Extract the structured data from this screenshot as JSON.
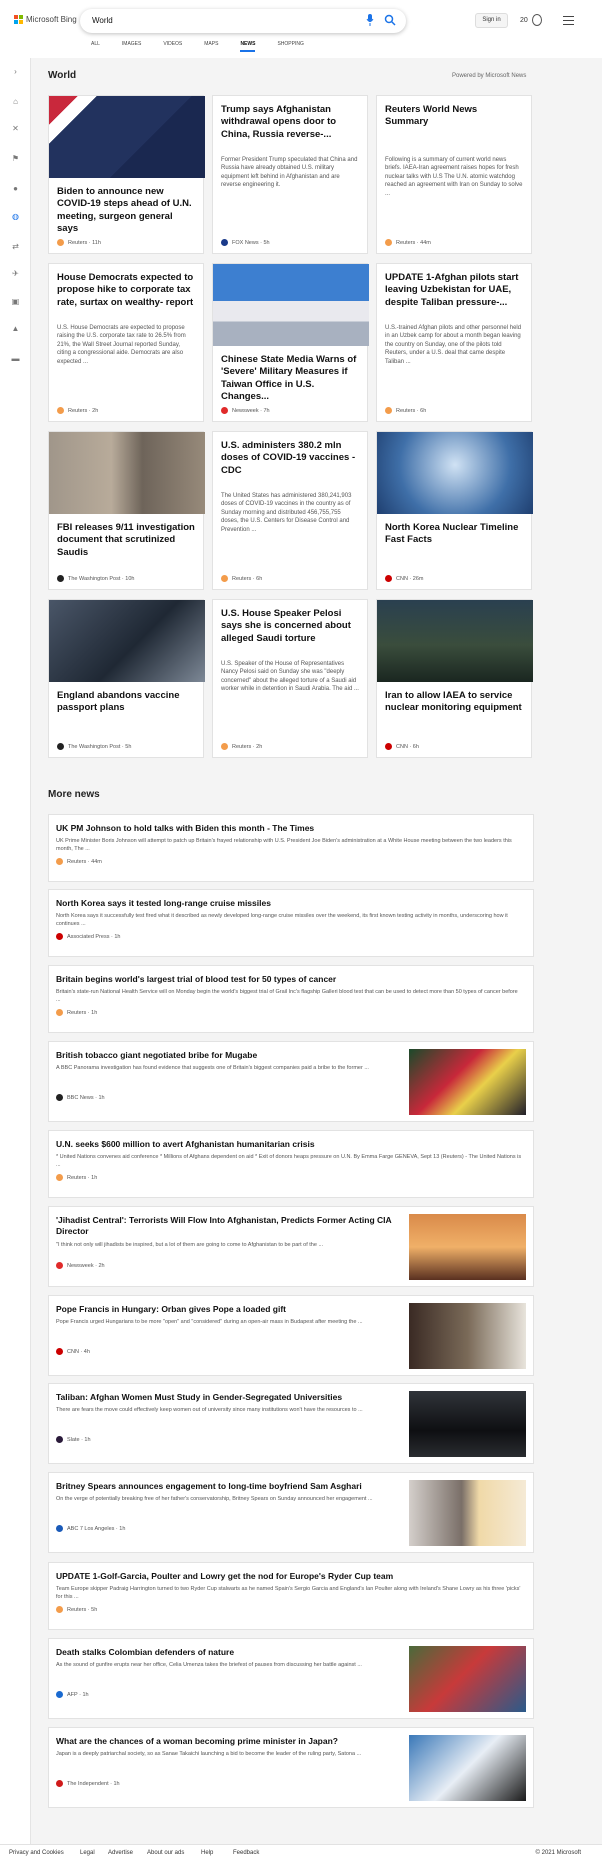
{
  "header": {
    "logo_text": "Microsoft Bing",
    "search_value": "World",
    "signin": "Sign in",
    "reward_count": "20"
  },
  "tabs": [
    "ALL",
    "IMAGES",
    "VIDEOS",
    "MAPS",
    "NEWS",
    "SHOPPING"
  ],
  "active_tab": "NEWS",
  "sidebar_icons": [
    "expand-icon",
    "home-icon",
    "sports-icon",
    "flag-icon",
    "location-icon",
    "globe-icon",
    "business-icon",
    "science-icon",
    "entertainment-icon",
    "politics-icon",
    "money-icon"
  ],
  "world": {
    "title": "World",
    "powered": "Powered by Microsoft News"
  },
  "cards": [
    {
      "title": "Biden to announce new COVID-19 steps ahead of U.N. meeting, surgeon general says",
      "snippet": "",
      "source": "Reuters · 11h",
      "fav": "#f39c4b"
    },
    {
      "title": "Trump says Afghanistan withdrawal opens door to China, Russia reverse-...",
      "snippet": "Former President Trump speculated that China and Russia have already obtained U.S. military equipment left behind in Afghanistan and are reverse engineering it.",
      "source": "FOX News · 5h",
      "fav": "#1a3a8a"
    },
    {
      "title": "Reuters World News Summary",
      "snippet": "Following is a summary of current world news briefs. IAEA-Iran agreement raises hopes for fresh nuclear talks with U.S The U.N. atomic watchdog reached an agreement with Iran on Sunday to solve ...",
      "source": "Reuters · 44m",
      "fav": "#f39c4b"
    },
    {
      "title": "House Democrats expected to propose hike to corporate tax rate, surtax on wealthy- report",
      "snippet": "U.S. House Democrats are expected to propose raising the U.S. corporate tax rate to 26.5% from 21%, the Wall Street Journal reported Sunday, citing a congressional aide. Democrats are also expected ...",
      "source": "Reuters · 2h",
      "fav": "#f39c4b"
    },
    {
      "title": "Chinese State Media Warns of 'Severe' Military Measures if Taiwan Office in U.S. Changes...",
      "snippet": "",
      "source": "Newsweek · 7h",
      "fav": "#e02a2a"
    },
    {
      "title": "UPDATE 1-Afghan pilots start leaving Uzbekistan for UAE, despite Taliban pressure-...",
      "snippet": "U.S.-trained Afghan pilots and other personnel held in an Uzbek camp for about a month began leaving the country on Sunday, one of the pilots told Reuters, under a U.S. deal that came despite Taliban ...",
      "source": "Reuters · 6h",
      "fav": "#f39c4b"
    },
    {
      "title": "FBI releases 9/11 investigation document that scrutinized Saudis",
      "snippet": "",
      "source": "The Washington Post · 10h",
      "fav": "#222"
    },
    {
      "title": "U.S. administers 380.2 mln doses of COVID-19 vaccines - CDC",
      "snippet": "The United States has administered 380,241,903 doses of COVID-19 vaccines in the country as of Sunday morning and distributed 456,755,755 doses, the U.S. Centers for Disease Control and Prevention ...",
      "source": "Reuters · 6h",
      "fav": "#f39c4b"
    },
    {
      "title": "North Korea Nuclear Timeline Fast Facts",
      "snippet": "",
      "source": "CNN · 26m",
      "fav": "#cc0000"
    },
    {
      "title": "England abandons vaccine passport plans",
      "snippet": "",
      "source": "The Washington Post · 5h",
      "fav": "#222"
    },
    {
      "title": "U.S. House Speaker Pelosi says she is concerned about alleged Saudi torture",
      "snippet": "U.S. Speaker of the House of Representatives Nancy Pelosi said on Sunday she was \"deeply concerned\" about the alleged torture of a Saudi aid worker while in detention in Saudi Arabia. The aid ...",
      "source": "Reuters · 2h",
      "fav": "#f39c4b"
    },
    {
      "title": "Iran to allow IAEA to service nuclear monitoring equipment",
      "snippet": "",
      "source": "CNN · 6h",
      "fav": "#cc0000"
    }
  ],
  "more_news": {
    "title": "More news",
    "items": [
      {
        "title": "UK PM Johnson to hold talks with Biden this month - The Times",
        "snippet": "UK Prime Minister Boris Johnson will attempt to patch up Britain's frayed relationship with U.S. President Joe Biden's administration at a White House meeting between the two leaders this month, The ...",
        "source": "Reuters · 44m",
        "fav": "#f39c4b"
      },
      {
        "title": "North Korea says it tested long-range cruise missiles",
        "snippet": "North Korea says it successfully test fired what it described as newly developed long-range cruise missiles over the weekend, its first known testing activity in months, underscoring how it continues ...",
        "source": "Associated Press · 1h",
        "fav": "#c00"
      },
      {
        "title": "Britain begins world's largest trial of blood test for 50 types of cancer",
        "snippet": "Britain's state-run National Health Service will on Monday begin the world's biggest trial of Grail Inc's flagship Galleri blood test that can be used to detect more than 50 types of cancer before ...",
        "source": "Reuters · 1h",
        "fav": "#f39c4b"
      },
      {
        "title": "British tobacco giant negotiated bribe for Mugabe",
        "snippet": "A BBC Panorama investigation has found evidence that suggests one of Britain's biggest companies paid a bribe to the former ...",
        "source": "BBC News · 1h",
        "fav": "#222"
      },
      {
        "title": "U.N. seeks $600 million to avert Afghanistan humanitarian crisis",
        "snippet": "* United Nations convenes aid conference * Millions of Afghans dependent on aid * Exit of donors heaps pressure on U.N. By Emma Farge GENEVA, Sept 13 (Reuters) - The United Nations is ...",
        "source": "Reuters · 1h",
        "fav": "#f39c4b"
      },
      {
        "title": "'Jihadist Central': Terrorists Will Flow Into Afghanistan, Predicts Former Acting CIA Director",
        "snippet": "\"I think not only will jihadists be inspired, but a lot of them are going to come to Afghanistan to be part of the ...",
        "source": "Newsweek · 2h",
        "fav": "#e02a2a"
      },
      {
        "title": "Pope Francis in Hungary: Orban gives Pope a loaded gift",
        "snippet": "Pope Francis urged Hungarians to be more \"open\" and \"considered\" during an open-air mass in Budapest after meeting the ...",
        "source": "CNN · 4h",
        "fav": "#cc0000"
      },
      {
        "title": "Taliban: Afghan Women Must Study in Gender-Segregated Universities",
        "snippet": "There are fears the move could effectively keep women out of university since many institutions won't have the resources to ...",
        "source": "Slate · 1h",
        "fav": "#2a1a3a"
      },
      {
        "title": "Britney Spears announces engagement to long-time boyfriend Sam Asghari",
        "snippet": "On the verge of potentially breaking free of her father's conservatorship, Britney Spears on Sunday announced her engagement ...",
        "source": "ABC 7 Los Angeles · 1h",
        "fav": "#1a5ab8"
      },
      {
        "title": "UPDATE 1-Golf-Garcia, Poulter and Lowry get the nod for Europe's Ryder Cup team",
        "snippet": "Team Europe skipper Padraig Harrington turned to two Ryder Cup stalwarts as he named Spain's Sergio Garcia and England's Ian Poulter along with Ireland's Shane Lowry as his three 'picks' for this ...",
        "source": "Reuters · 5h",
        "fav": "#f39c4b"
      },
      {
        "title": "Death stalks Colombian defenders of nature",
        "snippet": "As the sound of gunfire erupts near her office, Celia Umenza takes the briefest of pauses from discussing her battle against ...",
        "source": "AFP · 1h",
        "fav": "#1a6ad0"
      },
      {
        "title": "What are the chances of a woman becoming prime minister in Japan?",
        "snippet": "Japan is a deeply patriarchal society, so as Sanae Takaichi launching a bid to become the leader of the ruling party, Satona ...",
        "source": "The Independent · 1h",
        "fav": "#d01a1a"
      }
    ]
  },
  "footer": {
    "links": [
      "Privacy and Cookies",
      "Legal",
      "Advertise",
      "About our ads",
      "Help",
      "Feedback"
    ],
    "copyright": "© 2021 Microsoft"
  }
}
